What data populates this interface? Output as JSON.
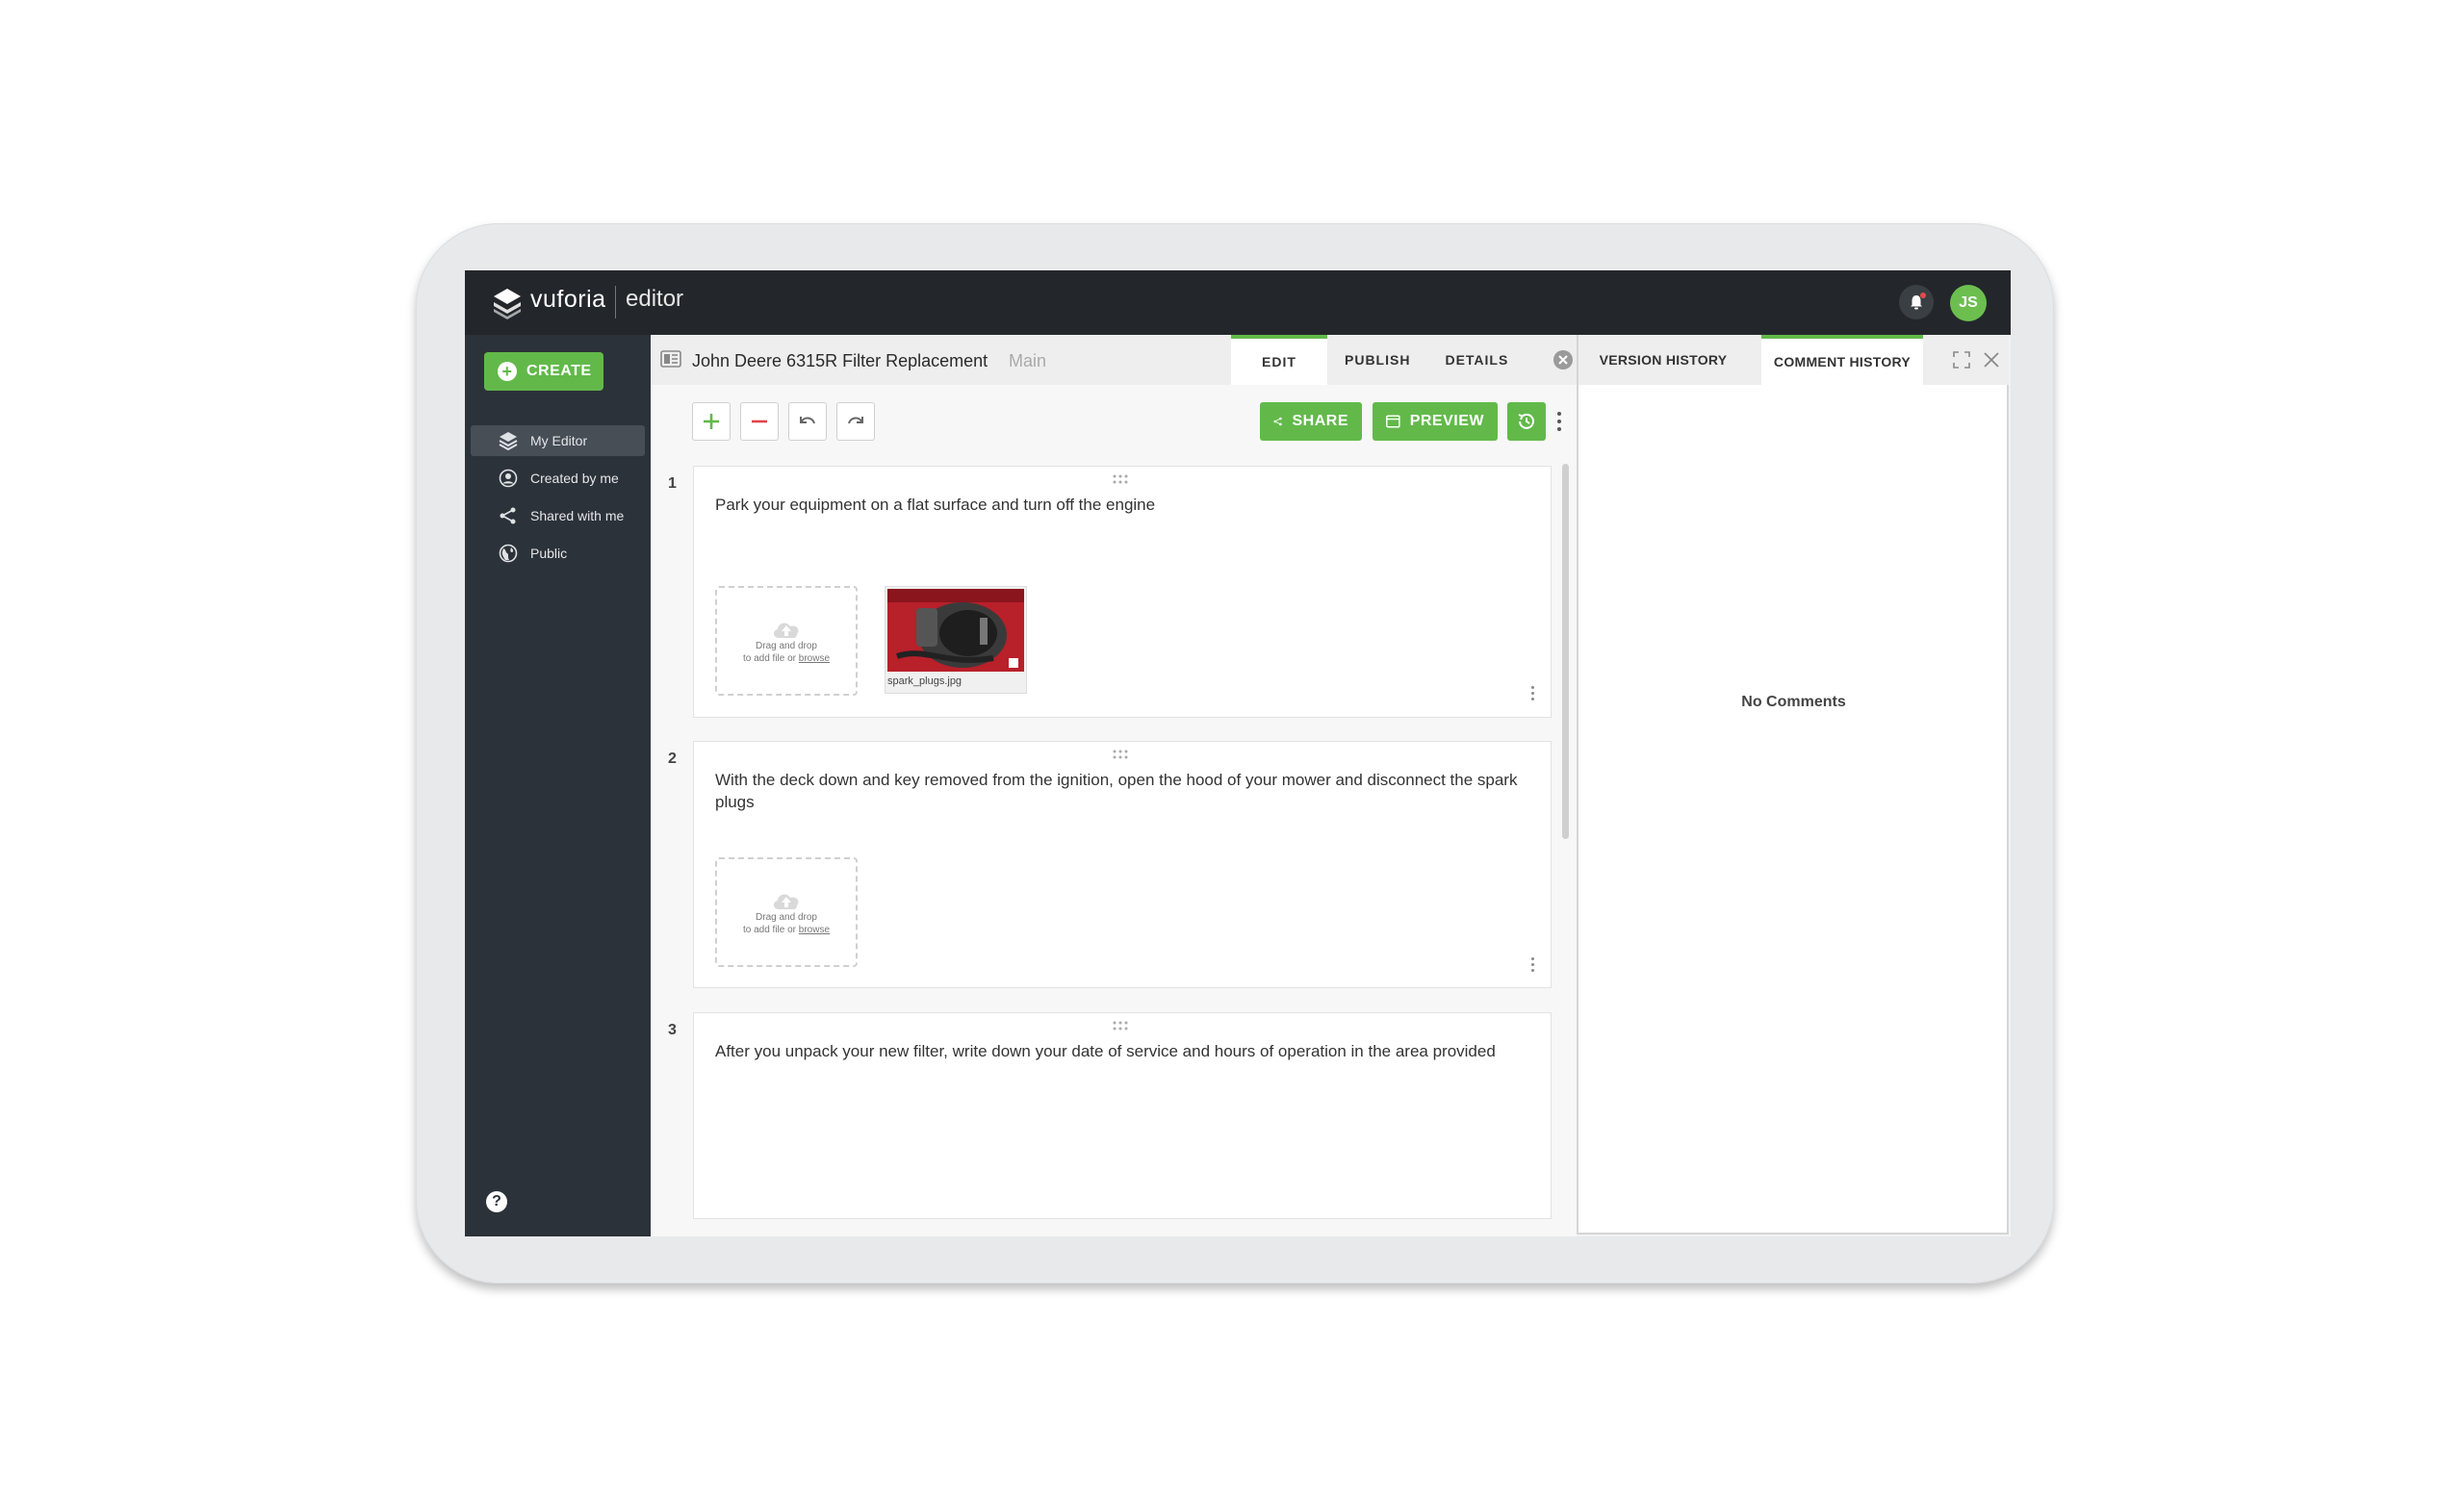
{
  "app": {
    "brand": "vuforia",
    "product": "editor",
    "user_initials": "JS"
  },
  "colors": {
    "accent": "#62b94a",
    "topbar": "#23272b",
    "sidebar": "#2c3239"
  },
  "sidebar": {
    "create_label": "CREATE",
    "items": [
      {
        "label": "My Editor",
        "icon": "layers-icon",
        "active": true
      },
      {
        "label": "Created by me",
        "icon": "user-circle-icon",
        "active": false
      },
      {
        "label": "Shared with me",
        "icon": "share-icon",
        "active": false
      },
      {
        "label": "Public",
        "icon": "globe-icon",
        "active": false
      }
    ],
    "help_label": "?"
  },
  "document": {
    "title": "John Deere 6315R Filter Replacement",
    "branch": "Main",
    "tabs": [
      {
        "label": "EDIT",
        "active": true
      },
      {
        "label": "PUBLISH",
        "active": false
      },
      {
        "label": "DETAILS",
        "active": false
      }
    ]
  },
  "toolbar": {
    "share_label": "SHARE",
    "preview_label": "PREVIEW"
  },
  "steps": [
    {
      "number": "1",
      "text": "Park your equipment on a flat surface and turn off the engine",
      "upload_line1": "Drag and drop",
      "upload_line2_prefix": "to add file or",
      "upload_browse": "browse",
      "attachment": "spark_plugs.jpg"
    },
    {
      "number": "2",
      "text": "With the deck down and key removed from the ignition, open the hood of your mower and disconnect the spark plugs",
      "upload_line1": "Drag and drop",
      "upload_line2_prefix": "to add file or",
      "upload_browse": "browse"
    },
    {
      "number": "3",
      "text": "After you unpack your new filter, write down your date of service and hours of operation in the area provided"
    }
  ],
  "panel": {
    "tabs": [
      {
        "label": "VERSION HISTORY",
        "active": false
      },
      {
        "label": "COMMENT HISTORY",
        "active": true
      }
    ],
    "empty_message": "No Comments"
  }
}
